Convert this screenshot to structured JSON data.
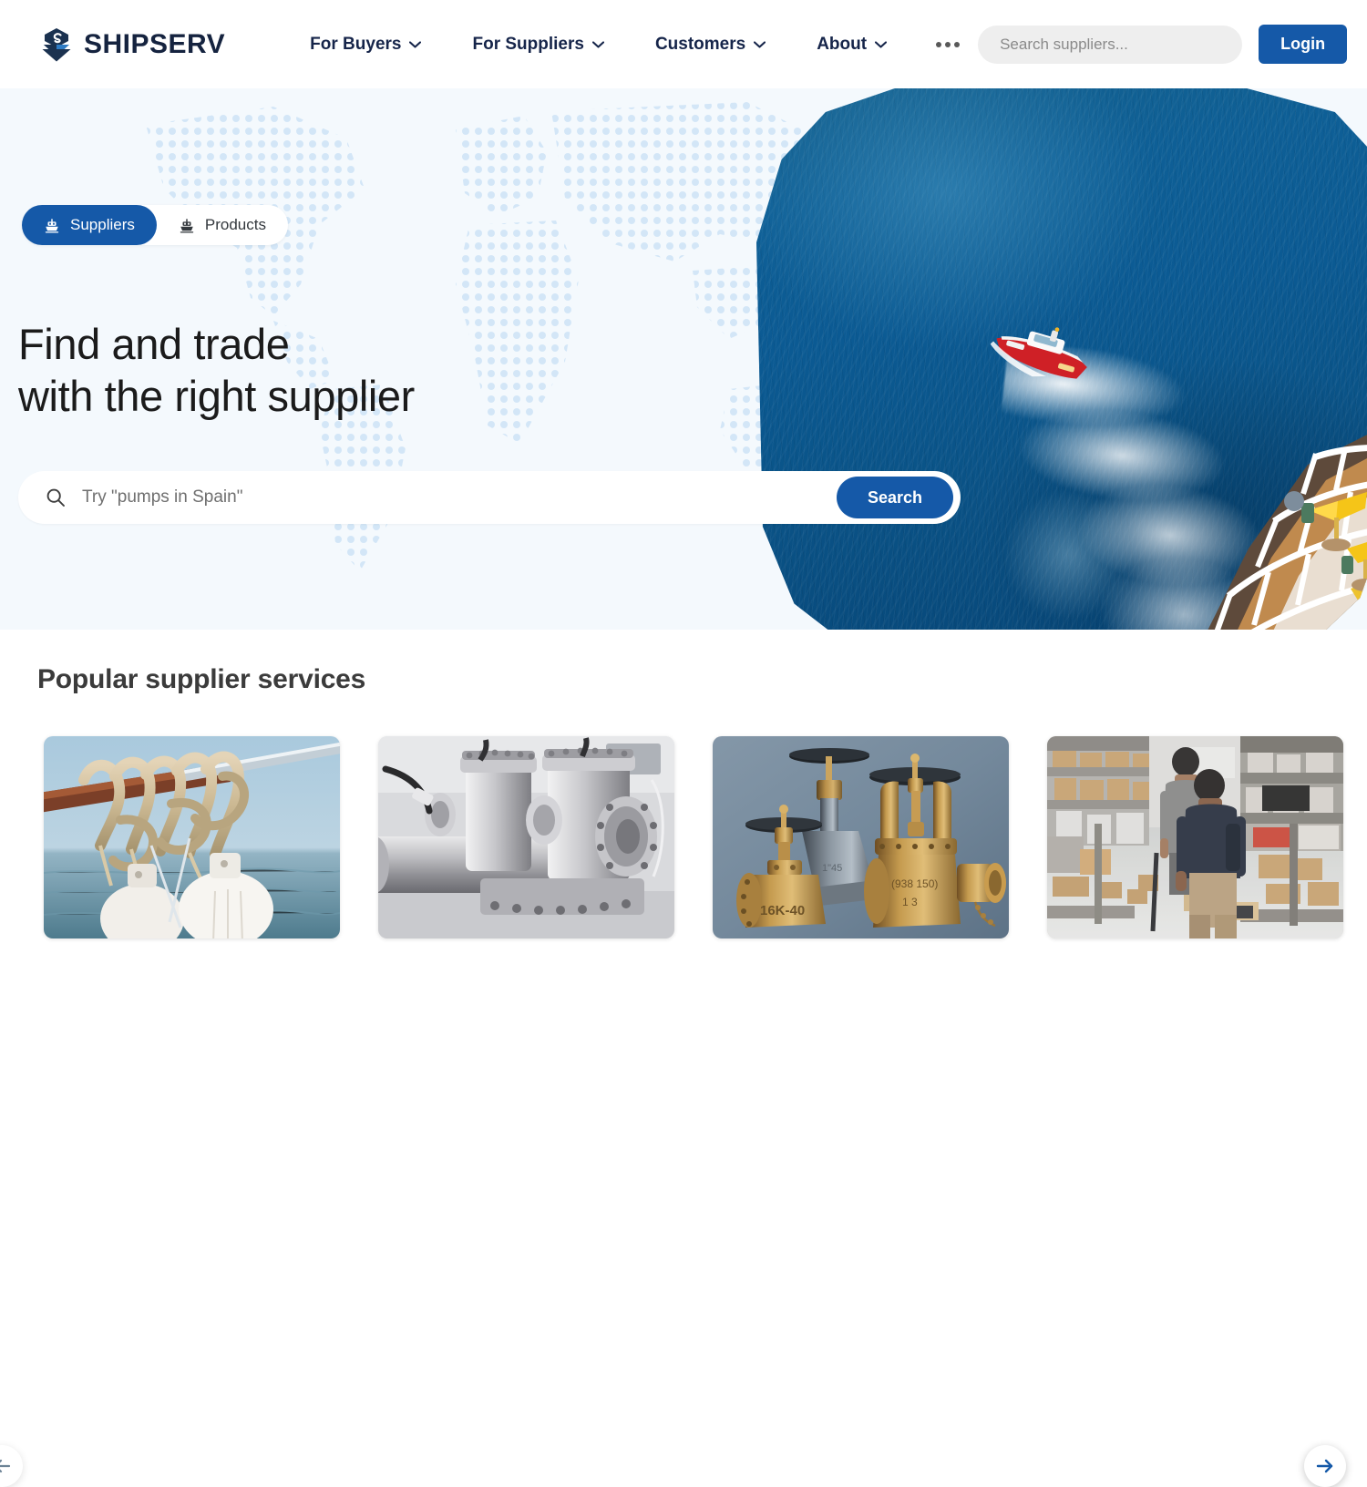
{
  "header": {
    "brand_name": "SHIPSERV",
    "brand_icon": "shipserv-logo-icon",
    "nav": [
      {
        "label": "For Buyers",
        "icon": "chevron-down-icon"
      },
      {
        "label": "For Suppliers",
        "icon": "chevron-down-icon"
      },
      {
        "label": "Customers",
        "icon": "chevron-down-icon"
      },
      {
        "label": "About",
        "icon": "chevron-down-icon"
      }
    ],
    "more_icon": "kebab-more-icon",
    "search": {
      "placeholder": "Search suppliers...",
      "value": ""
    },
    "login_label": "Login"
  },
  "hero": {
    "tabs": [
      {
        "label": "Suppliers",
        "icon": "ship-icon",
        "active": true
      },
      {
        "label": "Products",
        "icon": "ship-icon",
        "active": false
      }
    ],
    "title_line1": "Find and trade",
    "title_line2": "with the right supplier",
    "search": {
      "icon": "search-icon",
      "placeholder": "Try \"pumps in Spain\"",
      "value": "",
      "button_label": "Search"
    },
    "image_alt": "pilot-boat-at-sea"
  },
  "services": {
    "title": "Popular supplier services",
    "prev_icon": "arrow-left-icon",
    "next_icon": "arrow-right-icon",
    "cards": [
      {
        "alt": "mooring-ropes-and-fenders"
      },
      {
        "alt": "industrial-pipes-and-flanges"
      },
      {
        "alt": "bronze-marine-valves"
      },
      {
        "alt": "warehouse-aisle-workers"
      }
    ]
  },
  "colors": {
    "brand_navy": "#15233f",
    "accent_blue": "#1559a8",
    "hero_bg": "#f4f9fd",
    "map_dot": "#cfe3f5",
    "text_dark": "#1b1b1b",
    "muted_gray": "#6f6f6f"
  }
}
